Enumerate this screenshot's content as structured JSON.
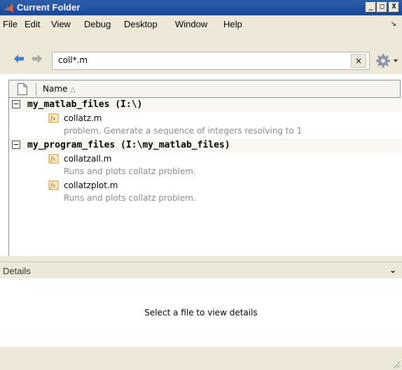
{
  "window": {
    "title": "Current Folder"
  },
  "window_controls": {
    "minimize": "_",
    "maximize": "□",
    "close": "X"
  },
  "menu": {
    "items": [
      "File",
      "Edit",
      "View",
      "Debug",
      "Desktop",
      "Window",
      "Help"
    ],
    "overflow_arrow": "↘"
  },
  "toolbar": {
    "search_value": "coll*.m",
    "clear_label": "×"
  },
  "columns": {
    "name": "Name",
    "sort_indicator": "△"
  },
  "groups": [
    {
      "label": "my_matlab_files (I:\\)",
      "expander": "−",
      "files": [
        {
          "name": "collatz.m",
          "description": "problem. Generate a sequence of integers resolving to 1"
        }
      ]
    },
    {
      "label": "my_program_files (I:\\my_matlab_files)",
      "expander": "−",
      "files": [
        {
          "name": "collatzall.m",
          "description": "Runs and plots collatz problem."
        },
        {
          "name": "collatzplot.m",
          "description": "Runs and plots collatz problem."
        }
      ]
    }
  ],
  "details": {
    "label": "Details",
    "message": "Select a file to view details",
    "chevron": "⌄"
  },
  "colors": {
    "titlebar": "#17479b",
    "chrome": "#ece9d8",
    "desc_text": "#8a8a8a"
  }
}
